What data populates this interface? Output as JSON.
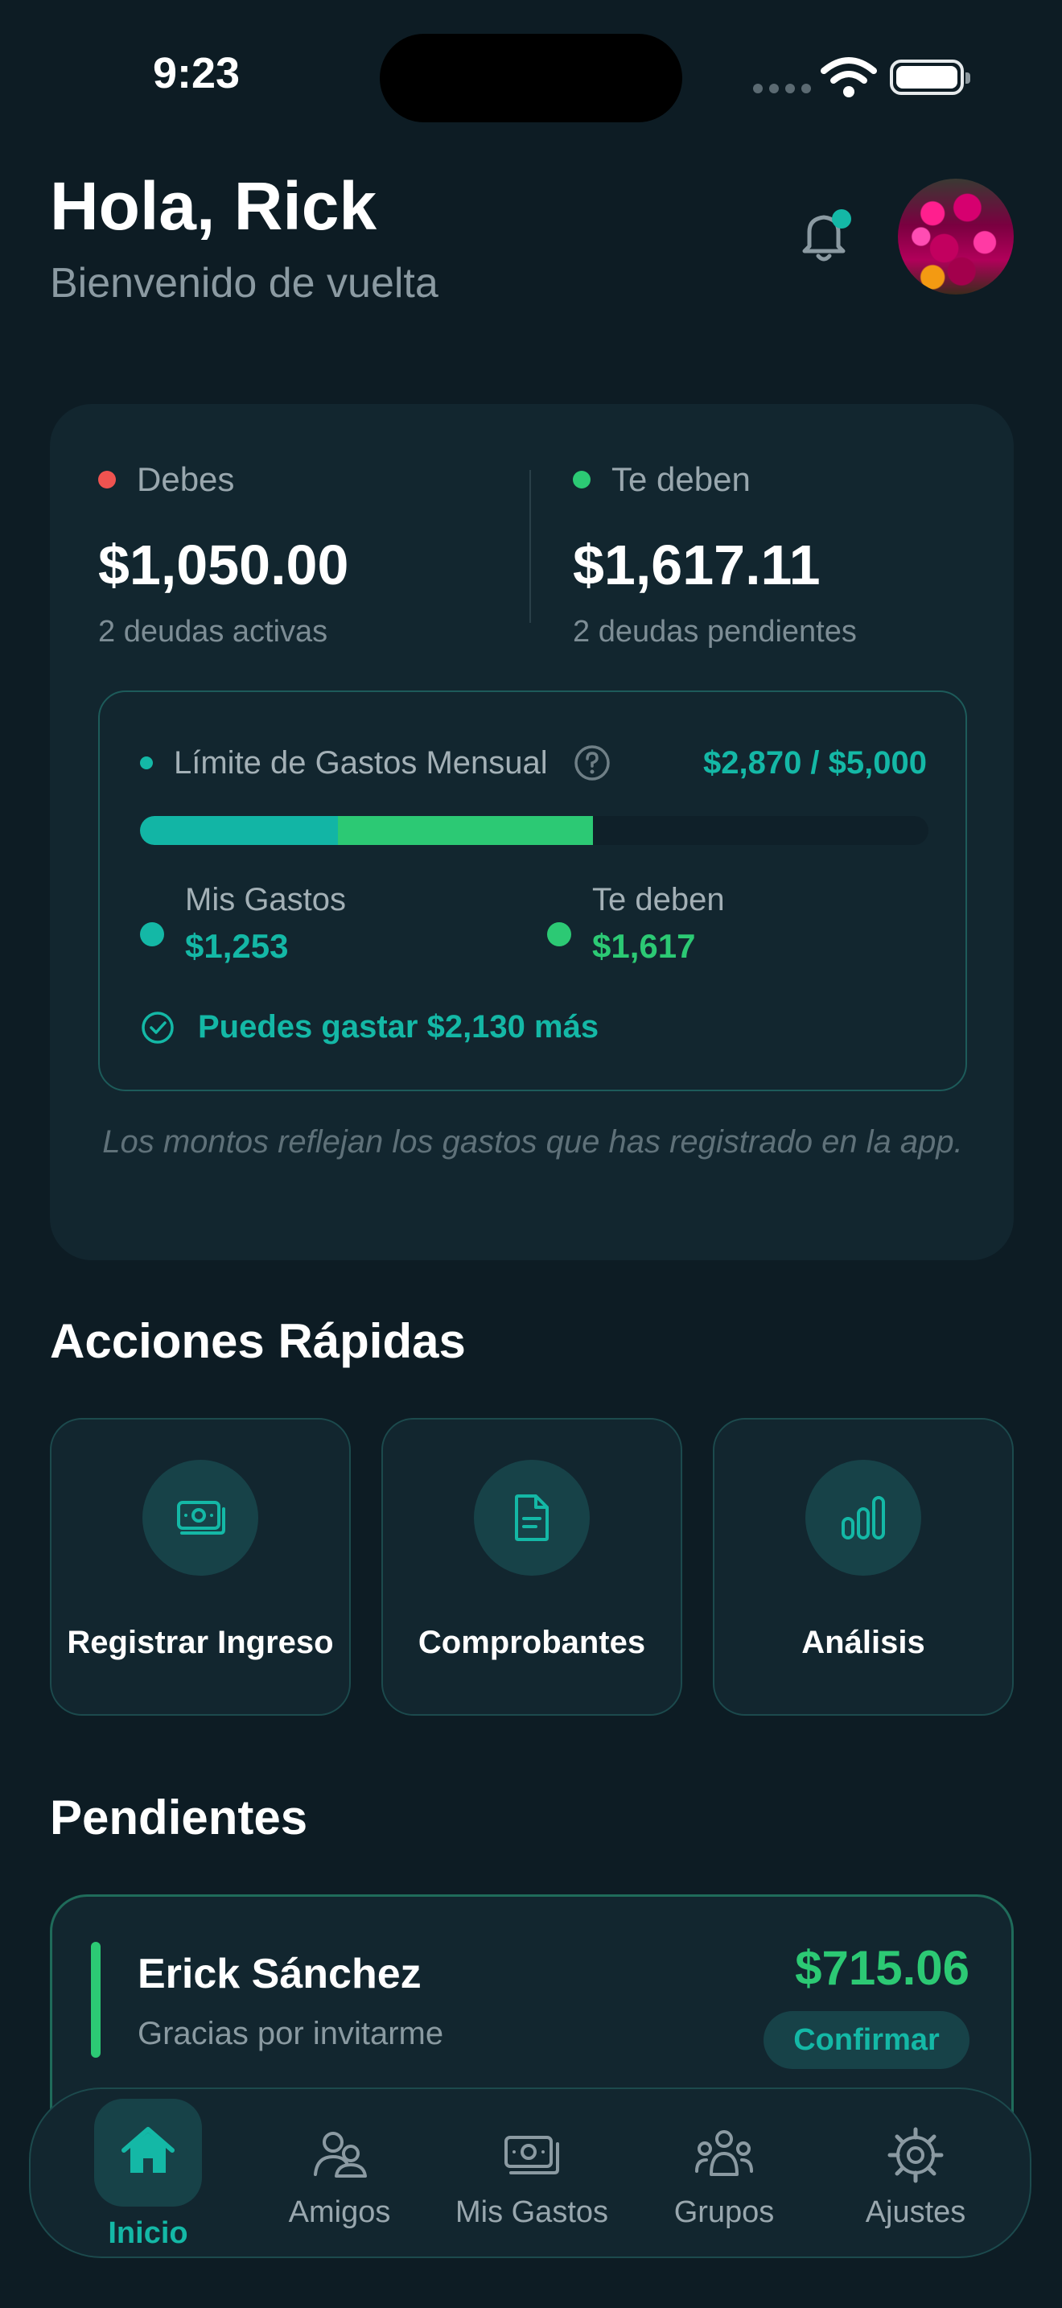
{
  "status_bar": {
    "time": "9:23"
  },
  "header": {
    "greeting": "Hola, Rick",
    "subtitle": "Bienvenido de vuelta",
    "icons": [
      "bell-icon",
      "avatar-photo"
    ]
  },
  "summary": {
    "owe": {
      "label": "Debes",
      "amount": "$1,050.00",
      "sub": "2 deudas activas",
      "dot_color": "#ef5350"
    },
    "owed": {
      "label": "Te deben",
      "amount": "$1,617.11",
      "sub": "2 deudas pendientes",
      "dot_color": "#2cc974"
    },
    "limit": {
      "label": "Límite de Gastos Mensual",
      "value": "$2,870 / $5,000",
      "segments": [
        {
          "name": "Mis Gastos",
          "amount": 1253,
          "color": "#12b5a5"
        },
        {
          "name": "Te deben",
          "amount": 1617,
          "color": "#2cc974"
        }
      ],
      "total": 5000,
      "legend": [
        {
          "label": "Mis Gastos",
          "value": "$1,253",
          "color": "#14b8a6"
        },
        {
          "label": "Te deben",
          "value": "$1,617",
          "color": "#2cc974"
        }
      ],
      "can_spend": "Puedes gastar $2,130 más"
    },
    "note": "Los montos reflejan los gastos que has registrado en la app."
  },
  "quick_actions": {
    "title": "Acciones Rápidas",
    "items": [
      {
        "label": "Registrar Ingreso",
        "icon": "money-icon"
      },
      {
        "label": "Comprobantes",
        "icon": "document-icon"
      },
      {
        "label": "Análisis",
        "icon": "bar-chart-icon"
      }
    ]
  },
  "pending": {
    "title": "Pendientes",
    "items": [
      {
        "name": "Erick Sánchez",
        "note": "Gracias por invitarme",
        "amount": "$715.06",
        "action": "Confirmar"
      }
    ]
  },
  "tab_bar": {
    "items": [
      {
        "label": "Inicio",
        "icon": "home-icon",
        "active": true
      },
      {
        "label": "Amigos",
        "icon": "users-icon",
        "active": false
      },
      {
        "label": "Mis Gastos",
        "icon": "money-icon",
        "active": false
      },
      {
        "label": "Grupos",
        "icon": "group-icon",
        "active": false
      },
      {
        "label": "Ajustes",
        "icon": "gear-icon",
        "active": false
      }
    ]
  },
  "colors": {
    "accent": "#14b8a6",
    "positive": "#2cc974",
    "negative": "#ef5350",
    "background": "#0d1c24",
    "card": "#12262f"
  }
}
